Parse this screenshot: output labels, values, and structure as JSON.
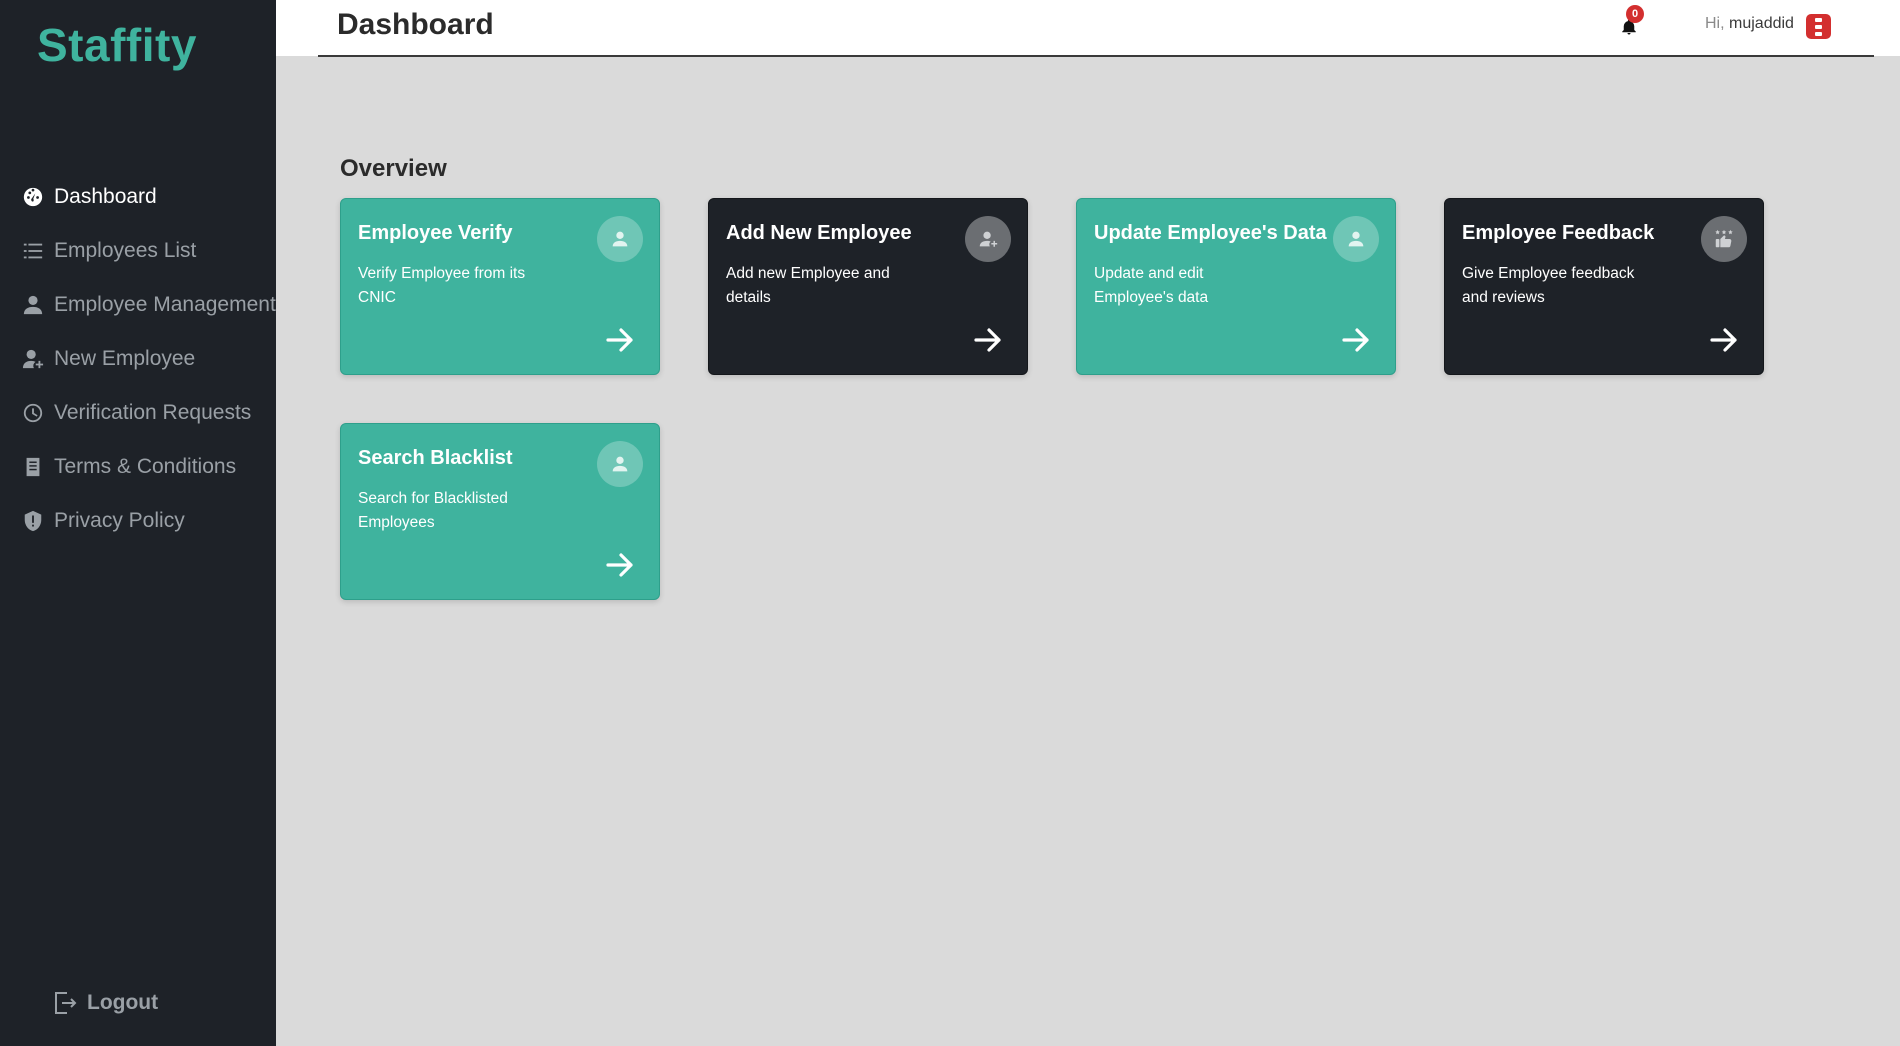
{
  "app": {
    "brand": "Staffity"
  },
  "sidebar": {
    "items": [
      {
        "label": "Dashboard",
        "icon": "gauge-icon",
        "active": true
      },
      {
        "label": "Employees List",
        "icon": "list-icon",
        "active": false
      },
      {
        "label": "Employee Management",
        "icon": "user-icon",
        "active": false
      },
      {
        "label": "New Employee",
        "icon": "user-plus-icon",
        "active": false
      },
      {
        "label": "Verification Requests",
        "icon": "clock-icon",
        "active": false
      },
      {
        "label": "Terms & Conditions",
        "icon": "document-icon",
        "active": false
      },
      {
        "label": "Privacy Policy",
        "icon": "shield-icon",
        "active": false
      }
    ],
    "logout_label": "Logout"
  },
  "header": {
    "title": "Dashboard",
    "notification_count": "0",
    "greeting_prefix": "Hi,",
    "username": "mujaddid"
  },
  "main": {
    "section_title": "Overview",
    "cards": [
      {
        "title": "Employee Verify",
        "description": "Verify Employee from its CNIC",
        "theme": "teal",
        "icon": "user-icon"
      },
      {
        "title": "Add New Employee",
        "description": "Add new Employee and details",
        "theme": "dark",
        "icon": "user-plus-icon"
      },
      {
        "title": "Update Employee's Data",
        "description": "Update and edit Employee's data",
        "theme": "teal",
        "icon": "user-icon"
      },
      {
        "title": "Employee Feedback",
        "description": "Give Employee feedback and reviews",
        "theme": "dark",
        "icon": "thumbs-up-stars-icon"
      },
      {
        "title": "Search Blacklist",
        "description": "Search for Blacklisted Employees",
        "theme": "teal",
        "icon": "user-icon"
      }
    ]
  },
  "colors": {
    "accent_teal": "#3fb39e",
    "sidebar_bg": "#1e2228",
    "content_bg": "#dadada",
    "badge_red": "#d32f2f"
  }
}
